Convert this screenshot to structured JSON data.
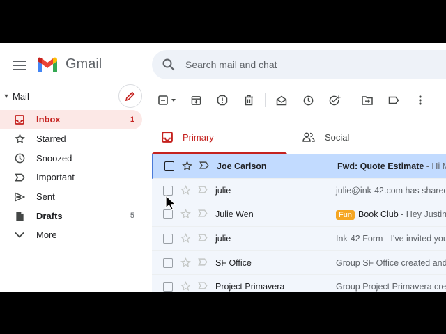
{
  "app": {
    "name": "Gmail"
  },
  "search": {
    "placeholder": "Search mail and chat"
  },
  "sidebar": {
    "section_label": "Mail",
    "items": [
      {
        "label": "Inbox",
        "count": "1",
        "icon": "inbox-icon"
      },
      {
        "label": "Starred",
        "count": "",
        "icon": "star-icon"
      },
      {
        "label": "Snoozed",
        "count": "",
        "icon": "clock-icon"
      },
      {
        "label": "Important",
        "count": "",
        "icon": "important-icon"
      },
      {
        "label": "Sent",
        "count": "",
        "icon": "send-icon"
      },
      {
        "label": "Drafts",
        "count": "5",
        "icon": "draft-icon"
      },
      {
        "label": "More",
        "count": "",
        "icon": "chevron-down-icon"
      }
    ]
  },
  "toolbar": {
    "icons": [
      "select-checkbox-icon",
      "archive-icon",
      "report-spam-icon",
      "delete-icon",
      "mark-read-icon",
      "snooze-icon",
      "add-task-icon",
      "move-to-icon",
      "label-icon",
      "more-vert-icon"
    ]
  },
  "tabs": [
    {
      "label": "Primary",
      "icon": "inbox-icon"
    },
    {
      "label": "Social",
      "icon": "people-icon"
    }
  ],
  "emails": [
    {
      "sender": "Joe Carlson",
      "badge": "",
      "subject": "Fwd: Quote Estimate",
      "snippet": " - Hi Mike",
      "selected": true,
      "unread": true
    },
    {
      "sender": "julie",
      "badge": "",
      "subject": "",
      "snippet": "julie@ink-42.com has shared",
      "selected": false,
      "unread": false
    },
    {
      "sender": "Julie Wen",
      "badge": "Fun",
      "subject": "Book Club",
      "snippet": " - Hey Justin",
      "selected": false,
      "unread": false
    },
    {
      "sender": "julie",
      "badge": "",
      "subject": "",
      "snippet": "Ink-42 Form - I've invited you",
      "selected": false,
      "unread": false
    },
    {
      "sender": "SF Office",
      "badge": "",
      "subject": "",
      "snippet": "Group SF Office created and",
      "selected": false,
      "unread": false
    },
    {
      "sender": "Project Primavera",
      "badge": "",
      "subject": "",
      "snippet": "Group Project Primavera crea",
      "selected": false,
      "unread": false
    }
  ],
  "colors": {
    "accent": "#c5221f",
    "selected_row": "#c2dbff",
    "row_bg": "#f2f6fc",
    "badge": "#f5a623"
  }
}
